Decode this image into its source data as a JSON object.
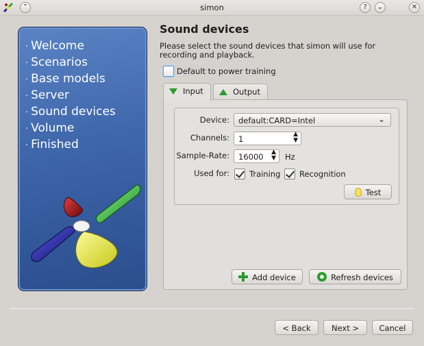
{
  "window": {
    "title": "simon",
    "buttons": {
      "help": "?",
      "minimize": "⌄",
      "close": "✕",
      "keep_above": "⌃"
    }
  },
  "sidebar": {
    "steps": [
      "Welcome",
      "Scenarios",
      "Base models",
      "Server",
      "Sound devices",
      "Volume",
      "Finished"
    ]
  },
  "page": {
    "heading": "Sound devices",
    "description": "Please select the sound devices that simon will use for recording and playback.",
    "power_training": {
      "label": "Default to power training",
      "checked": false
    }
  },
  "tabs": [
    {
      "label": "Input",
      "active": true
    },
    {
      "label": "Output",
      "active": false
    }
  ],
  "input": {
    "device_label": "Device:",
    "device_value": "default:CARD=Intel",
    "channels_label": "Channels:",
    "channels_value": "1",
    "samplerate_label": "Sample-Rate:",
    "samplerate_value": "16000",
    "samplerate_unit": "Hz",
    "usedfor_label": "Used for:",
    "training_label": "Training",
    "training_checked": true,
    "recognition_label": "Recognition",
    "recognition_checked": true,
    "test_label": "Test"
  },
  "actions": {
    "add_device": "Add device",
    "refresh_devices": "Refresh devices"
  },
  "footer": {
    "back": "< Back",
    "next": "Next >",
    "cancel": "Cancel"
  },
  "colors": {
    "sidebar": "#3e66aa",
    "accent_green": "#2e9c2e"
  }
}
